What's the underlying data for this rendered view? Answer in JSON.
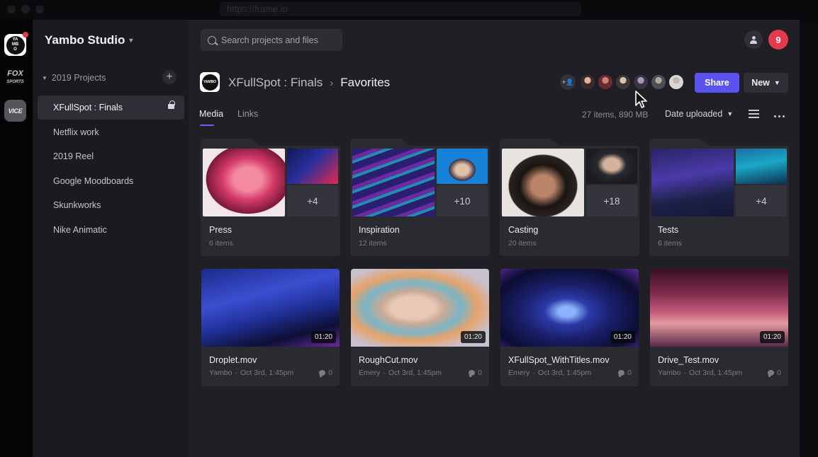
{
  "browser": {
    "url": "https://frame.io"
  },
  "rail": {
    "workspaces": [
      {
        "name": "yambo-logo",
        "label": "YAMBO"
      },
      {
        "name": "fox-sports-logo",
        "label": "FOX SPORTS"
      },
      {
        "name": "vice-logo",
        "label": "VICE"
      }
    ]
  },
  "sidebar": {
    "studio_name": "Yambo Studio",
    "section_label": "2019 Projects",
    "items": [
      {
        "label": "XFullSpot : Finals",
        "active": true,
        "locked": true
      },
      {
        "label": "Netflix work"
      },
      {
        "label": "2019 Reel"
      },
      {
        "label": "Google Moodboards"
      },
      {
        "label": "Skunkworks"
      },
      {
        "label": "Nike Animatic"
      }
    ]
  },
  "header": {
    "search_placeholder": "Search projects and files",
    "notification_count": "9",
    "breadcrumb": [
      "XFullSpot : Finals",
      "Favorites"
    ],
    "share_label": "Share",
    "new_label": "New"
  },
  "collaborators": {
    "colors": [
      "#c98a7a",
      "#a34d4d",
      "#d9c2b0",
      "#7b6c8e",
      "#8a8f98",
      "#e5e5e5"
    ]
  },
  "toolbar": {
    "tabs": [
      "Media",
      "Links"
    ],
    "meta": "27 items, 890 MB",
    "sort_label": "Date uploaded"
  },
  "folders": [
    {
      "name": "Press",
      "count": "6 items",
      "more": "+4"
    },
    {
      "name": "Inspiration",
      "count": "12 items",
      "more": "+10"
    },
    {
      "name": "Casting",
      "count": "20 items",
      "more": "+18"
    },
    {
      "name": "Tests",
      "count": "6 items",
      "more": "+4"
    }
  ],
  "videos": [
    {
      "name": "Droplet.mov",
      "author": "Yambo",
      "date": "Oct 3rd, 1:45pm",
      "comments": "0",
      "duration": "01:20"
    },
    {
      "name": "RoughCut.mov",
      "author": "Emery",
      "date": "Oct 3rd, 1:45pm",
      "comments": "0",
      "duration": "01:20"
    },
    {
      "name": "XFullSpot_WithTitles.mov",
      "author": "Emery",
      "date": "Oct 3rd, 1:45pm",
      "comments": "0",
      "duration": "01:20"
    },
    {
      "name": "Drive_Test.mov",
      "author": "Yambo",
      "date": "Oct 3rd, 1:45pm",
      "comments": "0",
      "duration": "01:20"
    }
  ],
  "colors": {
    "accent": "#5b53ef",
    "notification": "#e5394d",
    "panel": "#2a2a31",
    "sidebar": "#1a1a1f",
    "main": "#1f1f25"
  }
}
